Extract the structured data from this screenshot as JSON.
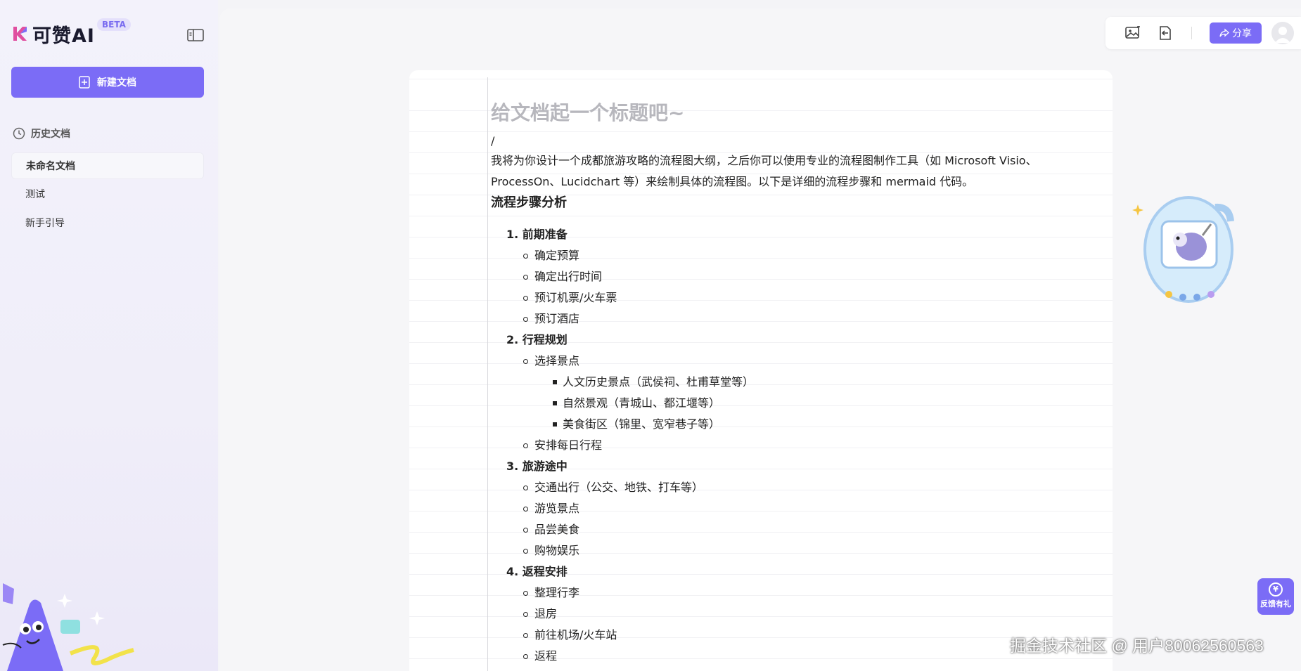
{
  "brand": {
    "name": "可赞AI",
    "badge": "BETA"
  },
  "sidebar": {
    "new_doc_label": "新建文档",
    "history_label": "历史文档",
    "items": [
      {
        "label": "未命名文档",
        "active": true
      },
      {
        "label": "测试",
        "active": false
      },
      {
        "label": "新手引导",
        "active": false
      }
    ]
  },
  "toolbar": {
    "share_label": "分享"
  },
  "document": {
    "title_placeholder": "给文档起一个标题吧~",
    "slash": "/",
    "intro_line1": "我将为你设计一个成都旅游攻略的流程图大纲，之后你可以使用专业的流程图制作工具（如 Microsoft Visio、",
    "intro_line2": "ProcessOn、Lucidchart 等）来绘制具体的流程图。以下是详细的流程步骤和 mermaid 代码。",
    "heading": "流程步骤分析",
    "sections": [
      {
        "title": "1. 前期准备",
        "items": [
          "确定预算",
          "确定出行时间",
          "预订机票/火车票",
          "预订酒店"
        ]
      },
      {
        "title": "2. 行程规划",
        "items": [
          "选择景点"
        ],
        "subitems": [
          "人文历史景点（武侯祠、杜甫草堂等）",
          "自然景观（青城山、都江堰等）",
          "美食街区（锦里、宽窄巷子等）"
        ],
        "items_after": [
          "安排每日行程"
        ]
      },
      {
        "title": "3. 旅游途中",
        "items": [
          "交通出行（公交、地铁、打车等）",
          "游览景点",
          "品尝美食",
          "购物娱乐"
        ]
      },
      {
        "title": "4. 返程安排",
        "items": [
          "整理行李",
          "退房",
          "前往机场/火车站",
          "返程"
        ]
      }
    ]
  },
  "feedback_label": "反馈有礼",
  "feedback_coin": "¥",
  "watermark": "掘金技术社区 @ 用户80062560563",
  "colors": {
    "accent": "#7b6cf6",
    "title_placeholder": "#b7b7bd"
  }
}
